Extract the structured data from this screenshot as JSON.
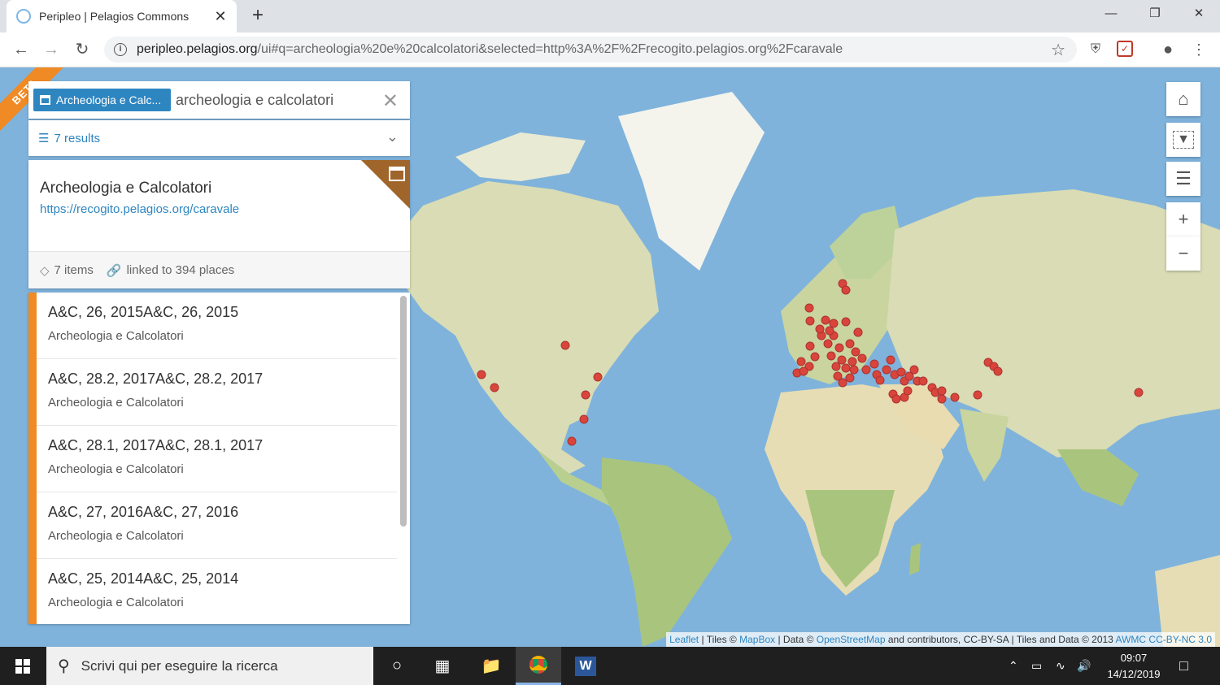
{
  "browser": {
    "tab_title": "Peripleo | Pelagios Commons",
    "tab_close": "✕",
    "new_tab": "+",
    "url_host": "peripleo.pelagios.org",
    "url_path": "/ui#q=archeologia%20e%20calcolatori&selected=http%3A%2F%2Frecogito.pelagios.org%2Fcaravale"
  },
  "search": {
    "tag_label": "Archeologia e Calc...",
    "query": "archeologia e calcolatori",
    "results_label": "7 results"
  },
  "badge": "BETA",
  "card": {
    "title": "Archeologia e Calcolatori",
    "url": "https://recogito.pelagios.org/caravale",
    "items": "7 items",
    "places": "linked to 394 places"
  },
  "items": [
    {
      "title": "A&C, 26, 2015A&C, 26, 2015",
      "subtitle": "Archeologia e Calcolatori"
    },
    {
      "title": "A&C, 28.2, 2017A&C, 28.2, 2017",
      "subtitle": "Archeologia e Calcolatori"
    },
    {
      "title": "A&C, 28.1, 2017A&C, 28.1, 2017",
      "subtitle": "Archeologia e Calcolatori"
    },
    {
      "title": "A&C, 27, 2016A&C, 27, 2016",
      "subtitle": "Archeologia e Calcolatori"
    },
    {
      "title": "A&C, 25, 2014A&C, 25, 2014",
      "subtitle": "Archeologia e Calcolatori"
    }
  ],
  "map": {
    "zoom_in": "+",
    "zoom_out": "−",
    "attribution": {
      "leaflet": "Leaflet",
      "tiles_prefix": " | Tiles © ",
      "mapbox": "MapBox",
      "data_prefix": " | Data © ",
      "osm": "OpenStreetMap",
      "middle": " and contributors, CC-BY-SA | Tiles and Data © 2013 ",
      "awmc": "AWMC CC-BY-NC 3.0"
    },
    "colors": {
      "water": "#7fb3dc",
      "land": "#d9dcb4",
      "marker": "#d9453b"
    }
  },
  "taskbar": {
    "search_placeholder": "Scrivi qui per eseguire la ricerca",
    "time": "09:07",
    "date": "14/12/2019"
  }
}
